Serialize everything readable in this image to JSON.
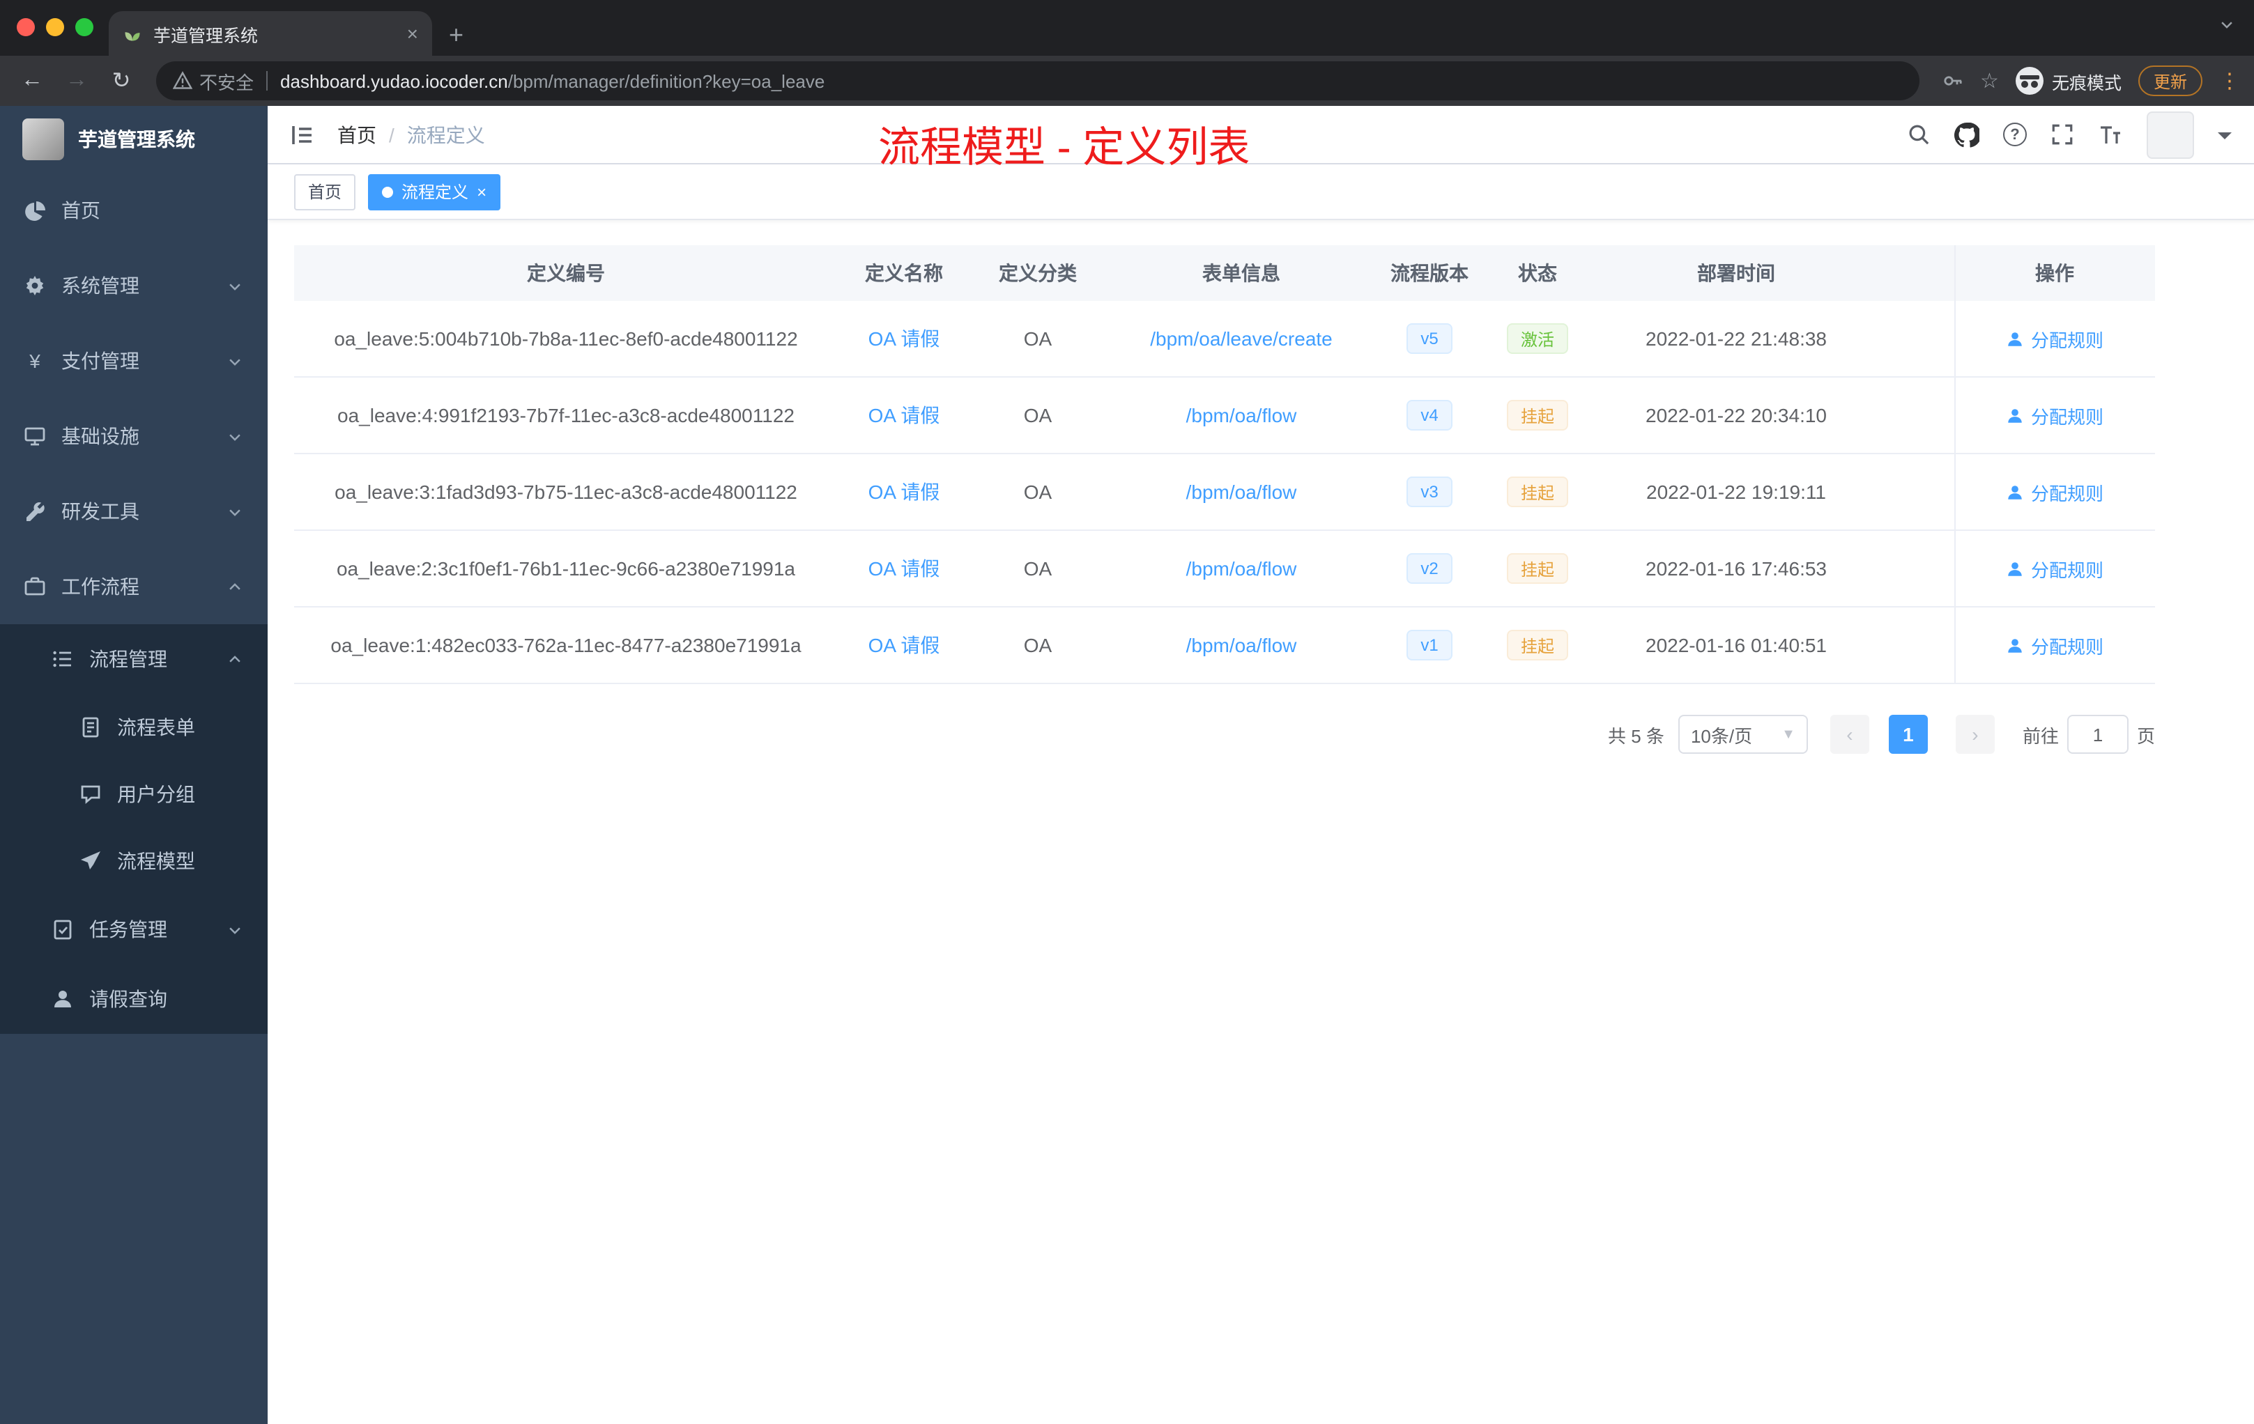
{
  "browser": {
    "tab_title": "芋道管理系统",
    "security_label": "不安全",
    "url_domain": "dashboard.yudao.iocoder.cn",
    "url_path": "/bpm/manager/definition?key=oa_leave",
    "incognito_label": "无痕模式",
    "update_label": "更新"
  },
  "sidebar": {
    "logo_title": "芋道管理系统",
    "items": [
      {
        "label": "首页"
      },
      {
        "label": "系统管理"
      },
      {
        "label": "支付管理"
      },
      {
        "label": "基础设施"
      },
      {
        "label": "研发工具"
      },
      {
        "label": "工作流程"
      },
      {
        "label": "流程管理"
      },
      {
        "label": "流程表单"
      },
      {
        "label": "用户分组"
      },
      {
        "label": "流程模型"
      },
      {
        "label": "任务管理"
      },
      {
        "label": "请假查询"
      }
    ]
  },
  "header": {
    "breadcrumb_home": "首页",
    "breadcrumb_current": "流程定义",
    "annotation": "流程模型 - 定义列表"
  },
  "tags": {
    "home": "首页",
    "active": "流程定义"
  },
  "table": {
    "columns": [
      "定义编号",
      "定义名称",
      "定义分类",
      "表单信息",
      "流程版本",
      "状态",
      "部署时间",
      "操作"
    ],
    "action_label": "分配规则",
    "rows": [
      {
        "id": "oa_leave:5:004b710b-7b8a-11ec-8ef0-acde48001122",
        "name": "OA 请假",
        "category": "OA",
        "form": "/bpm/oa/leave/create",
        "version": "v5",
        "status": "激活",
        "status_type": "success",
        "time": "2022-01-22 21:48:38"
      },
      {
        "id": "oa_leave:4:991f2193-7b7f-11ec-a3c8-acde48001122",
        "name": "OA 请假",
        "category": "OA",
        "form": "/bpm/oa/flow",
        "version": "v4",
        "status": "挂起",
        "status_type": "warning",
        "time": "2022-01-22 20:34:10"
      },
      {
        "id": "oa_leave:3:1fad3d93-7b75-11ec-a3c8-acde48001122",
        "name": "OA 请假",
        "category": "OA",
        "form": "/bpm/oa/flow",
        "version": "v3",
        "status": "挂起",
        "status_type": "warning",
        "time": "2022-01-22 19:19:11"
      },
      {
        "id": "oa_leave:2:3c1f0ef1-76b1-11ec-9c66-a2380e71991a",
        "name": "OA 请假",
        "category": "OA",
        "form": "/bpm/oa/flow",
        "version": "v2",
        "status": "挂起",
        "status_type": "warning",
        "time": "2022-01-16 17:46:53"
      },
      {
        "id": "oa_leave:1:482ec033-762a-11ec-8477-a2380e71991a",
        "name": "OA 请假",
        "category": "OA",
        "form": "/bpm/oa/flow",
        "version": "v1",
        "status": "挂起",
        "status_type": "warning",
        "time": "2022-01-16 01:40:51"
      }
    ]
  },
  "pagination": {
    "total": "共 5 条",
    "page_size": "10条/页",
    "current_page": "1",
    "goto_label": "前往",
    "goto_value": "1",
    "goto_unit": "页"
  },
  "colors": {
    "accent": "#409eff",
    "success": "#67c23a",
    "warning": "#e6a23c",
    "annotation_red": "#ee1c1c",
    "sidebar_bg": "#304156",
    "submenu_bg": "#1f2d3d"
  }
}
